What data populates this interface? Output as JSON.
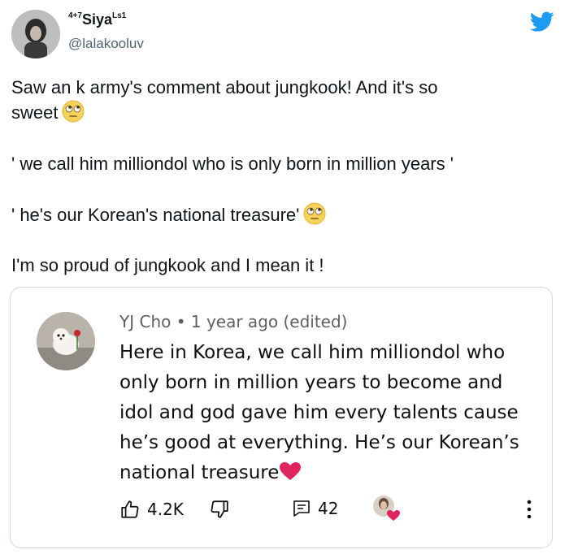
{
  "tweet": {
    "author_prefix": "4+7",
    "author_name": "Siya",
    "author_suffix": "Ls1",
    "handle": "@lalakooluv",
    "lines": [
      "Saw an k army's comment about jungkook! And it's so",
      "sweet",
      "' we call him milliondol who is only born in million years '",
      "' he's our Korean's national treasure'",
      "I'm so proud of jungkook and I mean it !"
    ]
  },
  "quote": {
    "author": "YJ Cho",
    "separator": "•",
    "time": "1 year ago (edited)",
    "comment_lines": [
      "Here in Korea, we call him milliondol who",
      "only born in million years to become and",
      "idol and god gave him every talents cause",
      "he’s good at everything. He’s our Korean’s",
      "national treasure"
    ],
    "likes": "4.2K",
    "replies": "42"
  },
  "colors": {
    "twitter_blue": "#1d9bf0",
    "heart_red": "#e0245e",
    "meta_gray": "#606060"
  },
  "icons": [
    "twitter-bird-icon",
    "face-with-rolling-eyes-emoji",
    "red-heart-emoji",
    "thumbs-up-icon",
    "thumbs-down-icon",
    "reply-icon",
    "heart-badge-icon",
    "more-vert-icon"
  ]
}
